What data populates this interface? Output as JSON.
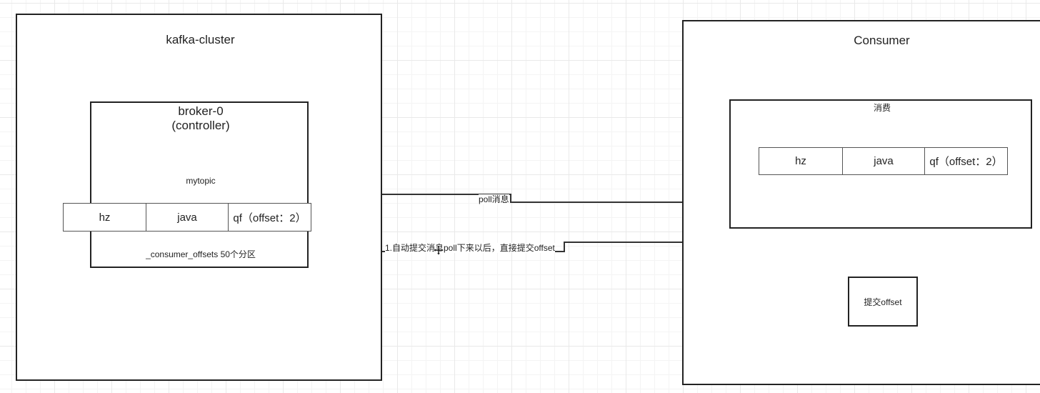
{
  "cluster": {
    "title": "kafka-cluster",
    "broker": {
      "name": "broker-0",
      "role": "(controller)",
      "topic": "mytopic",
      "partitions": [
        "hz",
        "java",
        "qf（offset：2）"
      ],
      "offsets_topic": "_consumer_offsets 50个分区"
    }
  },
  "consumer": {
    "title": "Consumer",
    "consume_box": {
      "label": "消费",
      "partitions": [
        "hz",
        "java",
        "qf（offset：2）"
      ]
    },
    "commit_box": {
      "label": "提交offset"
    }
  },
  "edges": {
    "poll": "poll消息",
    "auto_commit": "1.自动提交消息poll下来以后，直接提交offset"
  }
}
